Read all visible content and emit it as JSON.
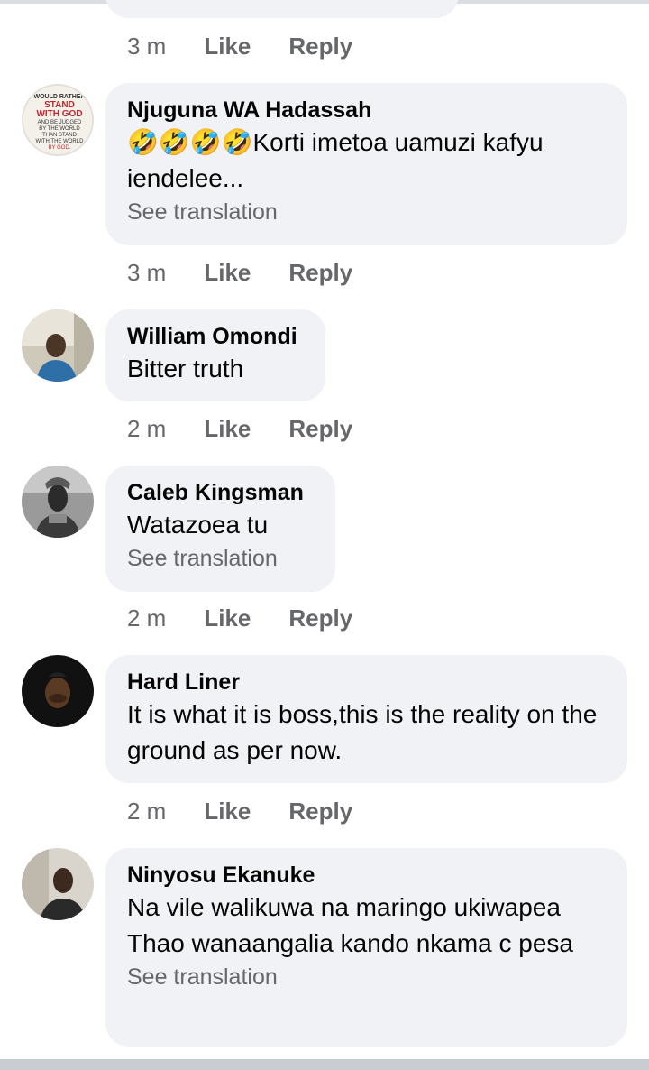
{
  "previous_actions": {
    "time": "3 m",
    "like": "Like",
    "reply": "Reply"
  },
  "comments": [
    {
      "author": "Njuguna WA Hadassah",
      "text": "🤣🤣🤣🤣Korti imetoa uamuzi kafyu iendelee...",
      "translate": "See translation",
      "time": "3 m",
      "like": "Like",
      "reply": "Reply",
      "avatar_text": "WOULD RATHER STAND WITH GOD AND BE JUDGED BY THE WORLD THAN STAND WITH THE WORLD AND BE JUDGED BY GOD."
    },
    {
      "author": "William Omondi",
      "text": "Bitter truth",
      "time": "2 m",
      "like": "Like",
      "reply": "Reply"
    },
    {
      "author": "Caleb Kingsman",
      "text": "Watazoea tu",
      "translate": "See translation",
      "time": "2 m",
      "like": "Like",
      "reply": "Reply"
    },
    {
      "author": "Hard Liner",
      "text": "It is what it is boss,this is the reality on the ground as per now.",
      "time": "2 m",
      "like": "Like",
      "reply": "Reply"
    },
    {
      "author": "Ninyosu Ekanuke",
      "text": "Na vile walikuwa na maringo ukiwapea Thao wanaangalia kando nkama c pesa",
      "translate": "See translation"
    }
  ]
}
